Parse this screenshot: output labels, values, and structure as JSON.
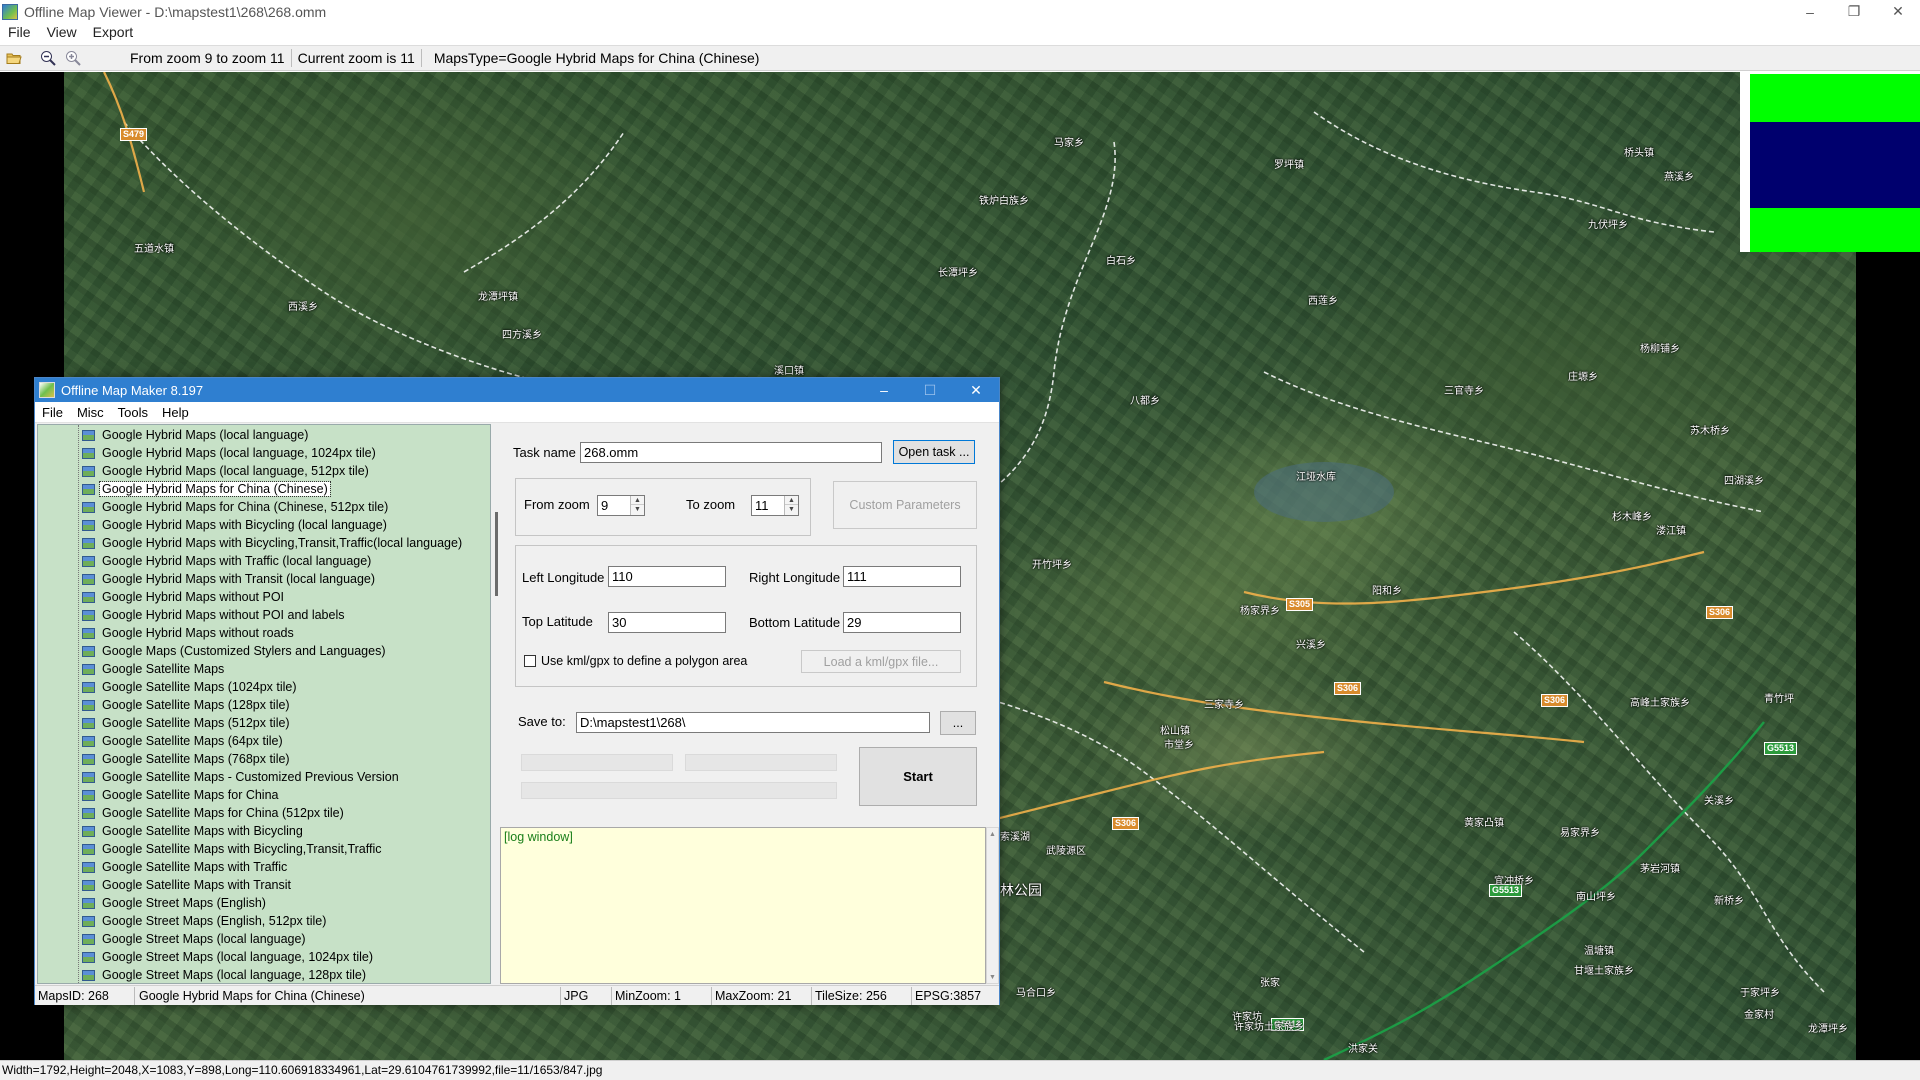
{
  "viewer": {
    "title": "Offline Map Viewer - D:\\mapstest1\\268\\268.omm",
    "menu": [
      "File",
      "View",
      "Export"
    ],
    "toolbar": {
      "zoom_range": "From zoom 9 to zoom 11",
      "current_zoom": "Current zoom is 11",
      "maps_type": "MapsType=Google Hybrid Maps for China (Chinese)"
    },
    "status": "Width=1792,Height=2048,X=1083,Y=898,Long=110.606918334961,Lat=29.6104761739992,file=11/1653/847.jpg",
    "win_buttons": [
      "–",
      "❐",
      "✕"
    ]
  },
  "map": {
    "place_labels": [
      "五道水镇",
      "西溪乡",
      "龙潭坪镇",
      "四方溪乡",
      "溪口镇",
      "罗坪镇",
      "马家乡",
      "铁炉白族乡",
      "长潭坪乡",
      "白石乡",
      "西莲乡",
      "九伏坪乡",
      "燕溪乡",
      "桥头镇",
      "杨柳铺乡",
      "三官寺乡",
      "庄塬乡",
      "八都乡",
      "江垭水库",
      "杉木峰乡",
      "溇江镇",
      "四湖溪乡",
      "开竹坪乡",
      "杨家界乡",
      "阳和乡",
      "苏木桥乡",
      "兴溪乡",
      "松山镇",
      "市堂乡",
      "三家寺乡",
      "甘堰土家族乡",
      "关溪乡",
      "索溪湖",
      "武陵源区",
      "黄家凸镇",
      "易家界乡",
      "茅岩河镇",
      "南山坪乡",
      "新桥乡",
      "青竹坪",
      "高峰土家族乡",
      "宜冲桥乡",
      "许家坊土家族乡",
      "温塘镇",
      "于家坪乡",
      "金家村",
      "龙潭坪乡",
      "林公园",
      "马合口乡",
      "许家坊",
      "张家",
      "洪家关"
    ],
    "road_badges": [
      "S479",
      "S305",
      "S306",
      "S306",
      "S306",
      "S306",
      "G5513",
      "G5513",
      "G5513"
    ]
  },
  "maker": {
    "title": "Offline Map Maker 8.197",
    "menu": [
      "File",
      "Misc",
      "Tools",
      "Help"
    ],
    "win_buttons": [
      "–",
      "☐",
      "✕"
    ],
    "map_types": [
      "Google Hybrid Maps (local language)",
      "Google Hybrid Maps (local language, 1024px tile)",
      "Google Hybrid Maps (local language, 512px tile)",
      "Google Hybrid Maps for China (Chinese)",
      "Google Hybrid Maps for China (Chinese, 512px tile)",
      "Google Hybrid Maps with Bicycling (local language)",
      "Google Hybrid Maps with Bicycling,Transit,Traffic(local language)",
      "Google Hybrid Maps with Traffic (local language)",
      "Google Hybrid Maps with Transit (local language)",
      "Google Hybrid Maps without POI",
      "Google Hybrid Maps without POI and labels",
      "Google Hybrid Maps without roads",
      "Google Maps (Customized Stylers and Languages)",
      "Google Satellite Maps",
      "Google Satellite Maps (1024px tile)",
      "Google Satellite Maps (128px tile)",
      "Google Satellite Maps (512px tile)",
      "Google Satellite Maps (64px tile)",
      "Google Satellite Maps (768px tile)",
      "Google Satellite Maps - Customized Previous Version",
      "Google Satellite Maps for China",
      "Google Satellite Maps for China (512px tile)",
      "Google Satellite Maps with Bicycling",
      "Google Satellite Maps with Bicycling,Transit,Traffic",
      "Google Satellite Maps with Traffic",
      "Google Satellite Maps with Transit",
      "Google Street Maps (English)",
      "Google Street Maps (English, 512px tile)",
      "Google Street Maps (local language)",
      "Google Street Maps (local language, 1024px tile)",
      "Google Street Maps (local language, 128px tile)"
    ],
    "selected_map_type": "Google Hybrid Maps for China (Chinese)",
    "form": {
      "task_name_label": "Task name",
      "task_name_value": "268.omm",
      "open_task_label": "Open task ...",
      "from_zoom_label": "From zoom",
      "from_zoom_value": "9",
      "to_zoom_label": "To zoom",
      "to_zoom_value": "11",
      "custom_params_label": "Custom Parameters",
      "left_longitude_label": "Left Longitude",
      "left_longitude_value": "110",
      "right_longitude_label": "Right Longitude",
      "right_longitude_value": "111",
      "top_latitude_label": "Top Latitude",
      "top_latitude_value": "30",
      "bottom_latitude_label": "Bottom Latitude",
      "bottom_latitude_value": "29",
      "use_kml_label": "Use kml/gpx to define a polygon area",
      "use_kml_checked": false,
      "load_kml_label": "Load a kml/gpx file...",
      "save_to_label": "Save to:",
      "save_to_value": "D:\\mapstest1\\268\\",
      "browse_label": "...",
      "start_label": "Start"
    },
    "log_text": "[log window]",
    "status": {
      "maps_id": "MapsID: 268",
      "maps_name": "Google Hybrid Maps for China (Chinese)",
      "format": "JPG",
      "min_zoom": "MinZoom: 1",
      "max_zoom": "MaxZoom: 21",
      "tile_size": "TileSize: 256",
      "epsg": "EPSG:3857"
    }
  }
}
